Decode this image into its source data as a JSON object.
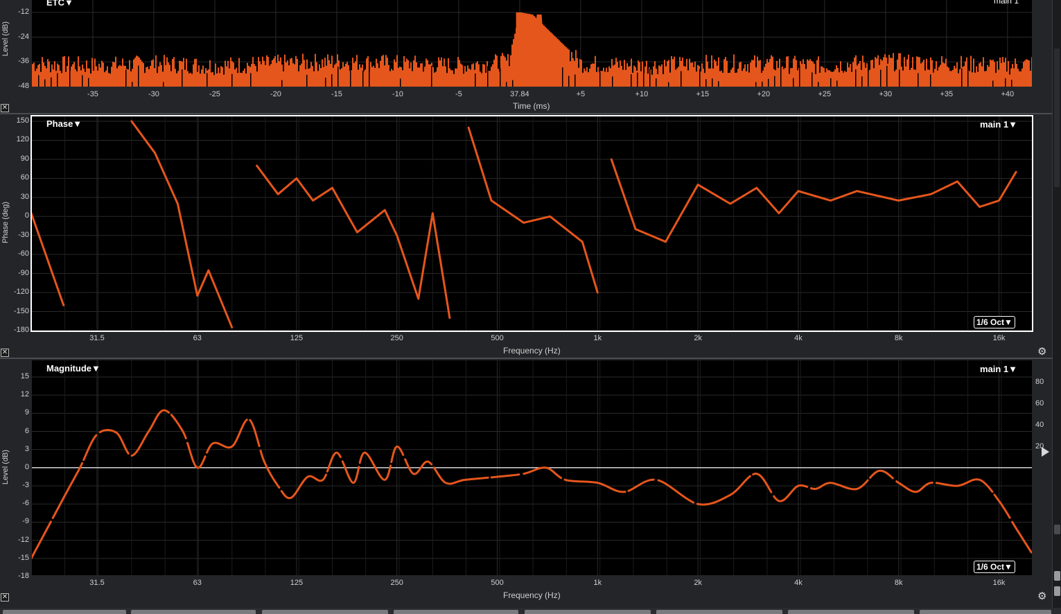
{
  "etc": {
    "title": "ETC▼",
    "channel": "main 1",
    "ylabel": "Level (dB)",
    "xlabel": "Time (ms)",
    "yticks": [
      "-12",
      "-24",
      "-36",
      "-48"
    ],
    "xticks": [
      "-35",
      "-30",
      "-25",
      "-20",
      "-15",
      "-10",
      "-5",
      "37.84",
      "+5",
      "+10",
      "+15",
      "+20",
      "+25",
      "+30",
      "+35",
      "+40"
    ]
  },
  "phase": {
    "title": "Phase▼",
    "channel": "main 1▼",
    "ylabel": "Phase (deg)",
    "xlabel": "Frequency (Hz)",
    "yticks": [
      "150",
      "120",
      "90",
      "60",
      "30",
      "0",
      "-30",
      "-60",
      "-90",
      "-120",
      "-150",
      "-180"
    ],
    "xticks": [
      "31.5",
      "63",
      "125",
      "250",
      "500",
      "1k",
      "2k",
      "4k",
      "8k",
      "16k"
    ],
    "smoothing": "1/6 Oct▼"
  },
  "magnitude": {
    "title": "Magnitude▼",
    "channel": "main 1▼",
    "ylabel": "Level (dB)",
    "xlabel": "Frequency (Hz)",
    "yticks": [
      "15",
      "12",
      "9",
      "6",
      "3",
      "0",
      "-3",
      "-6",
      "-9",
      "-12",
      "-15",
      "-18"
    ],
    "yticks_right": [
      "80",
      "60",
      "40",
      "20"
    ],
    "xticks": [
      "31.5",
      "63",
      "125",
      "250",
      "500",
      "1k",
      "2k",
      "4k",
      "8k",
      "16k"
    ],
    "smoothing": "1/6 Oct▼"
  },
  "colors": {
    "trace": "#e5561c",
    "background": "#000000",
    "grid": "#2b2b2b",
    "zero_line": "#ffffff"
  },
  "icons": {
    "close": "close-icon",
    "settings": "gear-icon"
  },
  "chart_data": [
    {
      "type": "area",
      "title": "ETC",
      "xlabel": "Time (ms)",
      "ylabel": "Level (dB)",
      "xlim": [
        -40,
        42
      ],
      "ylim": [
        -48,
        -6
      ],
      "x": [
        -40,
        -35,
        -30,
        -25,
        -20,
        -15,
        -10,
        -5,
        -1,
        0,
        1,
        5,
        10,
        15,
        20,
        25,
        30,
        35,
        40,
        42
      ],
      "y": [
        -36,
        -37,
        -36,
        -37,
        -36,
        -35,
        -36,
        -37,
        -35,
        -12,
        -13,
        -36,
        -37,
        -36,
        -36,
        -37,
        -35,
        -36,
        -37,
        -36
      ]
    },
    {
      "type": "line",
      "title": "Phase",
      "xlabel": "Frequency (Hz)",
      "ylabel": "Phase (deg)",
      "xscale": "log",
      "ylim": [
        -180,
        180
      ],
      "series": [
        {
          "name": "main 1",
          "x": [
            20,
            25,
            30,
            34,
            40,
            47,
            55,
            63,
            68,
            80,
            95,
            110,
            125,
            140,
            160,
            190,
            230,
            250,
            290,
            320,
            360,
            410,
            480,
            600,
            720,
            900,
            1000,
            1100,
            1300,
            1600,
            2000,
            2500,
            3000,
            3500,
            4000,
            5000,
            6000,
            8000,
            10000,
            12000,
            14000,
            16000,
            18000
          ],
          "y": [
            5,
            -140,
            130,
            -160,
            150,
            100,
            20,
            -125,
            -85,
            -175,
            80,
            35,
            60,
            25,
            45,
            -25,
            10,
            -30,
            -130,
            5,
            -160,
            140,
            25,
            -10,
            0,
            -40,
            -120,
            90,
            -20,
            -40,
            50,
            20,
            45,
            5,
            40,
            25,
            40,
            25,
            35,
            55,
            15,
            25,
            70
          ]
        }
      ]
    },
    {
      "type": "line",
      "title": "Magnitude",
      "xlabel": "Frequency (Hz)",
      "ylabel": "Level (dB)",
      "xscale": "log",
      "ylim": [
        -18,
        15
      ],
      "series": [
        {
          "name": "main 1",
          "x": [
            20,
            25,
            28,
            31.5,
            36,
            40,
            45,
            50,
            57,
            63,
            70,
            80,
            90,
            100,
            110,
            120,
            135,
            150,
            165,
            185,
            200,
            230,
            250,
            280,
            310,
            350,
            400,
            500,
            600,
            700,
            800,
            1000,
            1200,
            1500,
            2000,
            2500,
            3000,
            3500,
            4000,
            4500,
            5000,
            6000,
            7000,
            8000,
            9000,
            10000,
            12000,
            14000,
            16000,
            18000,
            20000
          ],
          "y": [
            -15,
            -5,
            0,
            5.5,
            5.8,
            2,
            6,
            9.5,
            6,
            0,
            4,
            3.5,
            8,
            1,
            -3,
            -5,
            -1.5,
            -2,
            2.5,
            -2.5,
            2.5,
            -2,
            3.5,
            -1,
            1,
            -2.5,
            -2,
            -1.5,
            -1,
            0,
            -2,
            -2.5,
            -4,
            -2,
            -6,
            -4.5,
            -1,
            -5.5,
            -3,
            -3.5,
            -2.5,
            -3.5,
            -0.5,
            -2.5,
            -4,
            -2.5,
            -3,
            -2,
            -5.5,
            -10,
            -14
          ]
        }
      ]
    }
  ]
}
